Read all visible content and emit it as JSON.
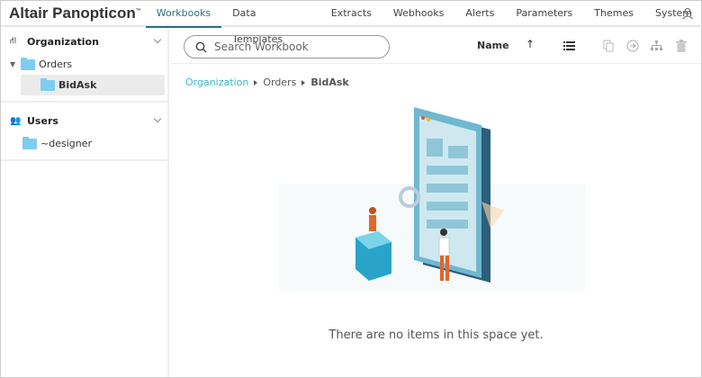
{
  "app": {
    "title": "Altair Panopticon",
    "tm": "™"
  },
  "tabs": [
    {
      "label": "Workbooks",
      "active": true
    },
    {
      "label": "Data Templates"
    },
    {
      "label": "Extracts"
    },
    {
      "label": "Webhooks"
    },
    {
      "label": "Alerts"
    },
    {
      "label": "Parameters"
    },
    {
      "label": "Themes"
    },
    {
      "label": "System"
    }
  ],
  "sidebar": {
    "organization": {
      "label": "Organization",
      "items": [
        {
          "label": "Orders"
        },
        {
          "label": "BidAsk"
        }
      ]
    },
    "users": {
      "label": "Users",
      "items": [
        {
          "label": "~designer"
        }
      ]
    }
  },
  "toolbar": {
    "search_placeholder": "Search Workbook",
    "sort_label": "Name",
    "sort_dir": "ascending"
  },
  "breadcrumb": [
    "Organization",
    "Orders",
    "BidAsk"
  ],
  "empty_message": "There are no items in this space yet.",
  "colors": {
    "accent": "#2c6e80",
    "link": "#3bb5c9",
    "folder": "#7dcdf0"
  }
}
